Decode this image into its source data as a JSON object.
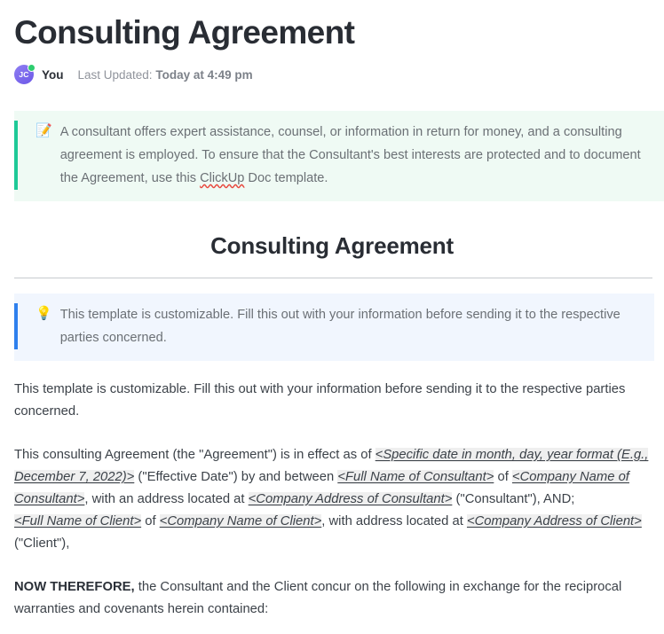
{
  "document": {
    "title": "Consulting Agreement",
    "meta": {
      "avatar_initials": "JC",
      "author": "You",
      "updated_label": "Last Updated:",
      "updated_value": "Today at 4:49 pm",
      "status": "online"
    },
    "intro_callout": {
      "icon": "memo-emoji",
      "glyph": "📝",
      "accent_color": "#1ec997",
      "background": "#effaf4",
      "text_before": "A consultant offers expert assistance, counsel, or information in return for money, and a consulting agreement is employed. To ensure that the Consultant's best interests are protected and to document the Agreement, use this ",
      "misspelled_word": "ClickUp",
      "text_after": " Doc template."
    },
    "section_heading": "Consulting Agreement",
    "tip_callout": {
      "icon": "lightbulb-emoji",
      "glyph": "💡",
      "accent_color": "#2f80ed",
      "background": "#f1f6fe",
      "text": "This template is customizable. Fill this out with your information before sending it to the respective parties concerned."
    },
    "paragraphs": {
      "customizable_note": "This template is customizable. Fill this out with your information before sending it to the respective parties concerned.",
      "agreement": {
        "lead": "This consulting Agreement (the \"Agreement\") is in effect as of ",
        "ph_effective_date": "<Specific date in month, day, year format (E.g., December 7, 2022)>",
        "after_date": " (\"Effective Date\") by and between ",
        "ph_consultant_name": "<Full Name of Consultant>",
        "of_1": " of ",
        "ph_consultant_company": "<Company Name of Consultant>",
        "address_1": ", with an address located at ",
        "ph_consultant_address": "<Company Address of Consultant>",
        "consultant_tail": " (\"Consultant\"), AND;",
        "ph_client_name": "<Full Name of Client>",
        "of_2": " of ",
        "ph_client_company": "<Company Name of Client>",
        "address_2": ", with address located at ",
        "ph_client_address": "<Company Address of Client>",
        "client_tail": " (\"Client\"),"
      },
      "now_therefore": {
        "bold_lead": "NOW THEREFORE,",
        "rest": " the Consultant and the Client concur on the following in exchange for the reciprocal warranties and covenants herein contained:"
      }
    }
  }
}
